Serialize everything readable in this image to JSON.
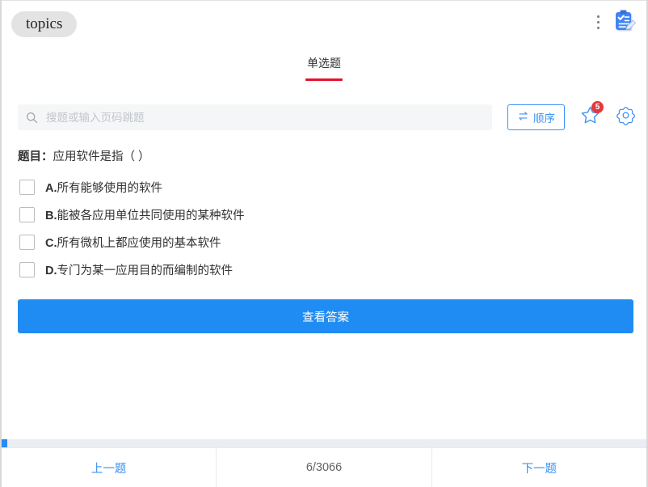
{
  "topbar": {
    "tab_chip_label": "topics",
    "kebab_icon": "more-vertical-icon",
    "app_icon": "clipboard-check-pencil-icon"
  },
  "section": {
    "tabs": [
      {
        "label": "单选题",
        "active": true
      }
    ],
    "indicator_color": "#e8122d"
  },
  "search": {
    "placeholder": "搜题或输入页码跳题",
    "value": "",
    "icon": "search-icon"
  },
  "toolbar": {
    "order_button": {
      "label": "顺序",
      "icon": "swap-arrows-icon",
      "color": "#3d93f6"
    },
    "favorite_button": {
      "icon": "star-outline-icon",
      "badge": "5",
      "badge_color": "#e4393c",
      "color": "#3d93f6"
    },
    "settings_button": {
      "icon": "gear-icon",
      "color": "#3d93f6"
    }
  },
  "question": {
    "label": "题目：",
    "text": "应用软件是指（ ）",
    "options": [
      {
        "key": "A.",
        "text": "所有能够使用的软件",
        "checked": false
      },
      {
        "key": "B.",
        "text": "能被各应用单位共同使用的某种软件",
        "checked": false
      },
      {
        "key": "C.",
        "text": "所有微机上都应使用的基本软件",
        "checked": false
      },
      {
        "key": "D.",
        "text": "专门为某一应用目的而编制的软件",
        "checked": false
      }
    ],
    "answer_button_label": "查看答案",
    "answer_button_color": "#1f8cf4"
  },
  "footer": {
    "prev_label": "上一题",
    "counter": "6/3066",
    "next_label": "下一题"
  }
}
